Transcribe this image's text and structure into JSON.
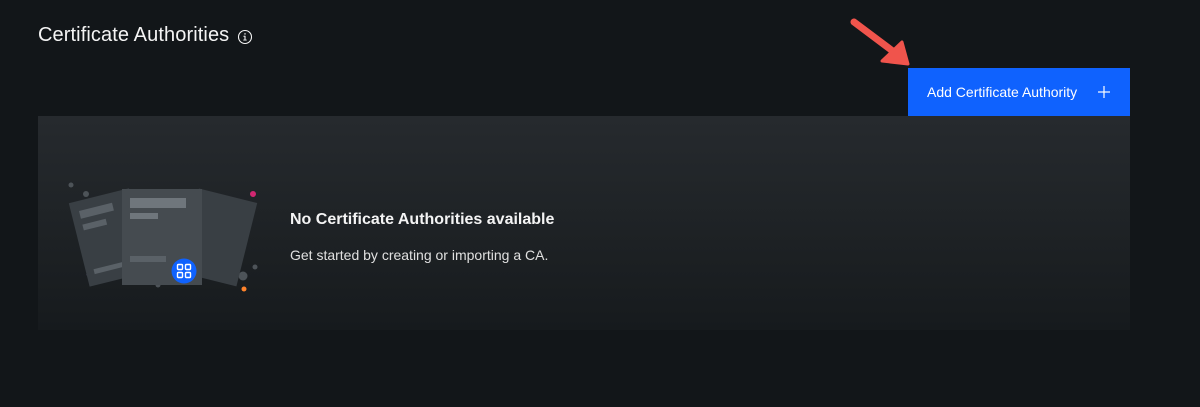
{
  "header": {
    "title": "Certificate Authorities",
    "info_icon": "info-icon"
  },
  "toolbar": {
    "add_label": "Add Certificate Authority",
    "add_icon": "plus-icon",
    "accent_color": "#0f62fe"
  },
  "empty_state": {
    "title": "No Certificate Authorities available",
    "description": "Get started by creating or importing a CA.",
    "illustration": "certificate-documents-illustration",
    "badge_icon": "grid-icon"
  },
  "annotation": {
    "arrow_color": "#f0544c"
  }
}
